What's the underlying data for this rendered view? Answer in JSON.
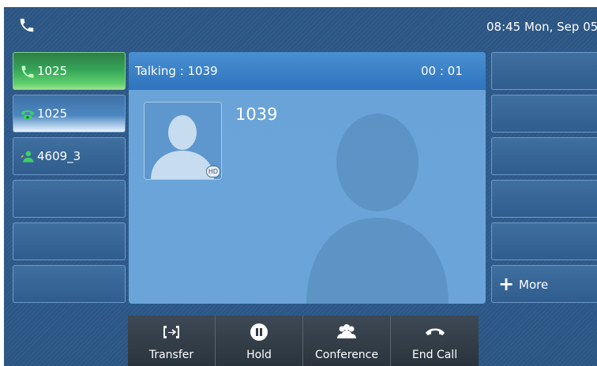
{
  "status_bar": {
    "time": "08:45 Mon, Sep 05"
  },
  "line_keys": [
    {
      "label": "1025",
      "state": "active"
    },
    {
      "label": "1025",
      "state": "held"
    },
    {
      "label": "4609_3",
      "state": "contact"
    },
    {
      "label": ""
    },
    {
      "label": ""
    },
    {
      "label": ""
    }
  ],
  "call": {
    "status": "Talking : 1039",
    "timer": "00 : 01",
    "number": "1039",
    "hd_label": "HD"
  },
  "dss_keys": {
    "more_label": "More"
  },
  "softkeys": [
    {
      "label": "Transfer"
    },
    {
      "label": "Hold"
    },
    {
      "label": "Conference"
    },
    {
      "label": "End Call"
    }
  ],
  "colors": {
    "active_green": "#34a357",
    "panel_blue": "#6aa3d8",
    "header_blue": "#2d74bf",
    "softkey_dark": "#2a343e"
  }
}
